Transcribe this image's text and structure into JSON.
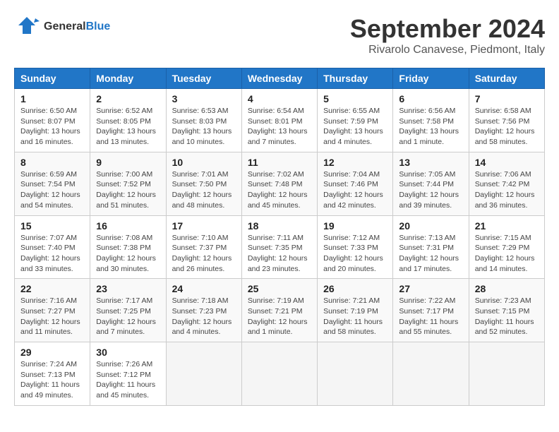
{
  "header": {
    "logo_line1": "General",
    "logo_line2": "Blue",
    "month_title": "September 2024",
    "location": "Rivarolo Canavese, Piedmont, Italy"
  },
  "columns": [
    "Sunday",
    "Monday",
    "Tuesday",
    "Wednesday",
    "Thursday",
    "Friday",
    "Saturday"
  ],
  "weeks": [
    [
      {
        "day": "1",
        "info": "Sunrise: 6:50 AM\nSunset: 8:07 PM\nDaylight: 13 hours\nand 16 minutes."
      },
      {
        "day": "2",
        "info": "Sunrise: 6:52 AM\nSunset: 8:05 PM\nDaylight: 13 hours\nand 13 minutes."
      },
      {
        "day": "3",
        "info": "Sunrise: 6:53 AM\nSunset: 8:03 PM\nDaylight: 13 hours\nand 10 minutes."
      },
      {
        "day": "4",
        "info": "Sunrise: 6:54 AM\nSunset: 8:01 PM\nDaylight: 13 hours\nand 7 minutes."
      },
      {
        "day": "5",
        "info": "Sunrise: 6:55 AM\nSunset: 7:59 PM\nDaylight: 13 hours\nand 4 minutes."
      },
      {
        "day": "6",
        "info": "Sunrise: 6:56 AM\nSunset: 7:58 PM\nDaylight: 13 hours\nand 1 minute."
      },
      {
        "day": "7",
        "info": "Sunrise: 6:58 AM\nSunset: 7:56 PM\nDaylight: 12 hours\nand 58 minutes."
      }
    ],
    [
      {
        "day": "8",
        "info": "Sunrise: 6:59 AM\nSunset: 7:54 PM\nDaylight: 12 hours\nand 54 minutes."
      },
      {
        "day": "9",
        "info": "Sunrise: 7:00 AM\nSunset: 7:52 PM\nDaylight: 12 hours\nand 51 minutes."
      },
      {
        "day": "10",
        "info": "Sunrise: 7:01 AM\nSunset: 7:50 PM\nDaylight: 12 hours\nand 48 minutes."
      },
      {
        "day": "11",
        "info": "Sunrise: 7:02 AM\nSunset: 7:48 PM\nDaylight: 12 hours\nand 45 minutes."
      },
      {
        "day": "12",
        "info": "Sunrise: 7:04 AM\nSunset: 7:46 PM\nDaylight: 12 hours\nand 42 minutes."
      },
      {
        "day": "13",
        "info": "Sunrise: 7:05 AM\nSunset: 7:44 PM\nDaylight: 12 hours\nand 39 minutes."
      },
      {
        "day": "14",
        "info": "Sunrise: 7:06 AM\nSunset: 7:42 PM\nDaylight: 12 hours\nand 36 minutes."
      }
    ],
    [
      {
        "day": "15",
        "info": "Sunrise: 7:07 AM\nSunset: 7:40 PM\nDaylight: 12 hours\nand 33 minutes."
      },
      {
        "day": "16",
        "info": "Sunrise: 7:08 AM\nSunset: 7:38 PM\nDaylight: 12 hours\nand 30 minutes."
      },
      {
        "day": "17",
        "info": "Sunrise: 7:10 AM\nSunset: 7:37 PM\nDaylight: 12 hours\nand 26 minutes."
      },
      {
        "day": "18",
        "info": "Sunrise: 7:11 AM\nSunset: 7:35 PM\nDaylight: 12 hours\nand 23 minutes."
      },
      {
        "day": "19",
        "info": "Sunrise: 7:12 AM\nSunset: 7:33 PM\nDaylight: 12 hours\nand 20 minutes."
      },
      {
        "day": "20",
        "info": "Sunrise: 7:13 AM\nSunset: 7:31 PM\nDaylight: 12 hours\nand 17 minutes."
      },
      {
        "day": "21",
        "info": "Sunrise: 7:15 AM\nSunset: 7:29 PM\nDaylight: 12 hours\nand 14 minutes."
      }
    ],
    [
      {
        "day": "22",
        "info": "Sunrise: 7:16 AM\nSunset: 7:27 PM\nDaylight: 12 hours\nand 11 minutes."
      },
      {
        "day": "23",
        "info": "Sunrise: 7:17 AM\nSunset: 7:25 PM\nDaylight: 12 hours\nand 7 minutes."
      },
      {
        "day": "24",
        "info": "Sunrise: 7:18 AM\nSunset: 7:23 PM\nDaylight: 12 hours\nand 4 minutes."
      },
      {
        "day": "25",
        "info": "Sunrise: 7:19 AM\nSunset: 7:21 PM\nDaylight: 12 hours\nand 1 minute."
      },
      {
        "day": "26",
        "info": "Sunrise: 7:21 AM\nSunset: 7:19 PM\nDaylight: 11 hours\nand 58 minutes."
      },
      {
        "day": "27",
        "info": "Sunrise: 7:22 AM\nSunset: 7:17 PM\nDaylight: 11 hours\nand 55 minutes."
      },
      {
        "day": "28",
        "info": "Sunrise: 7:23 AM\nSunset: 7:15 PM\nDaylight: 11 hours\nand 52 minutes."
      }
    ],
    [
      {
        "day": "29",
        "info": "Sunrise: 7:24 AM\nSunset: 7:13 PM\nDaylight: 11 hours\nand 49 minutes."
      },
      {
        "day": "30",
        "info": "Sunrise: 7:26 AM\nSunset: 7:12 PM\nDaylight: 11 hours\nand 45 minutes."
      },
      {
        "day": "",
        "info": ""
      },
      {
        "day": "",
        "info": ""
      },
      {
        "day": "",
        "info": ""
      },
      {
        "day": "",
        "info": ""
      },
      {
        "day": "",
        "info": ""
      }
    ]
  ]
}
